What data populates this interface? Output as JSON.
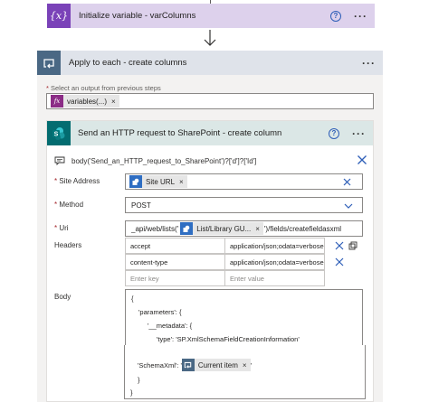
{
  "init_variable": {
    "icon": "braces-x-icon",
    "icon_text": "{x}",
    "title": "Initialize variable - varColumns",
    "help": "?",
    "more": "···"
  },
  "apply_each": {
    "title": "Apply to each - create columns",
    "more": "···",
    "select_label_required": "*",
    "select_label": " Select an output from previous steps",
    "select_token": {
      "icon_text": "fx",
      "label": "variables(...)",
      "close": "×"
    }
  },
  "http_action": {
    "title": "Send an HTTP request to SharePoint - create column",
    "help": "?",
    "more": "···",
    "expression": "body('Send_an_HTTP_request_to_SharePoint')?['d']?['Id']",
    "fields": {
      "site_address": {
        "required": "*",
        "label": " Site Address",
        "token_label": "Site URL",
        "token_close": "×"
      },
      "method": {
        "required": "*",
        "label": " Method",
        "value": "POST"
      },
      "uri": {
        "required": "*",
        "label": " Uri",
        "prefix": "_api/web/lists('",
        "token_label": "List/Library GU...",
        "token_close": "×",
        "suffix": "')/fields/createfieldasxml"
      },
      "headers": {
        "label": "Headers",
        "rows": [
          {
            "key": "accept",
            "value": "application/json;odata=verbose"
          },
          {
            "key": "content-type",
            "value": "application/json;odata=verbose"
          }
        ],
        "key_placeholder": "Enter key",
        "value_placeholder": "Enter value"
      },
      "body": {
        "label": "Body",
        "line1": "{",
        "line2": "'parameters': {",
        "line3": "'__metadata': {",
        "line4": "'type': 'SP.XmlSchemaFieldCreationInformation'",
        "line5": "},",
        "line6_prefix": "'SchemaXml': '",
        "line6_token": "Current item",
        "line6_close": "×",
        "line6_suffix": "'",
        "line7": "}",
        "line8": "}"
      }
    }
  },
  "colors": {
    "init_accent": "#7a42b8",
    "apply_accent": "#4a6884",
    "sharepoint_accent": "#036c70",
    "link_blue": "#2f5fb8",
    "required_red": "#a4262c"
  }
}
